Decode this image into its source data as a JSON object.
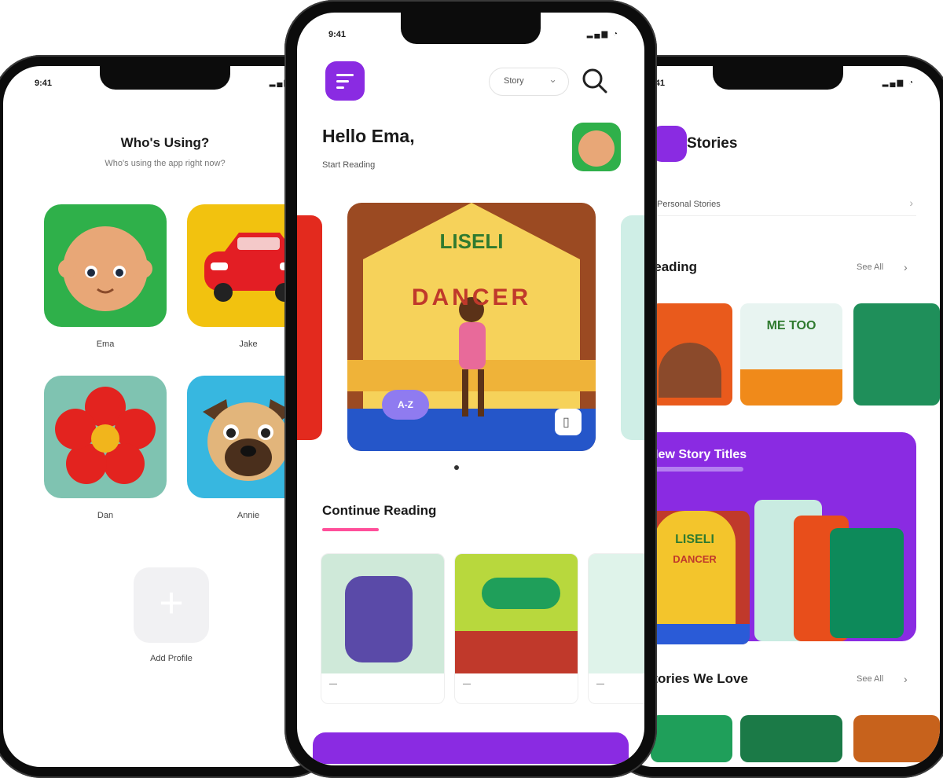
{
  "left_phone": {
    "status_time": "9:41",
    "title": "Who's Using?",
    "subtitle": "Who's using the app right now?",
    "profiles": [
      {
        "name": "Ema"
      },
      {
        "name": "Jake"
      },
      {
        "name": "Dan"
      },
      {
        "name": "Annie"
      }
    ],
    "add_label": "Add Profile"
  },
  "center_phone": {
    "status_time": "9:41",
    "language": "Story",
    "greeting": "Hello Ema,",
    "subgreeting": "Start Reading",
    "featured": {
      "cover_title_1": "LISELI",
      "cover_title_2": "DANCER",
      "level_badge": "A-Z"
    },
    "continue_title": "Continue Reading",
    "continue_books": [
      {
        "caption": "—"
      },
      {
        "caption": "—"
      },
      {
        "caption": "—"
      }
    ]
  },
  "right_phone": {
    "status_time": "9:41",
    "title": "Stories",
    "filter_label": "Personal Stories",
    "reading_title": "Reading",
    "see_all_1": "See All",
    "small_cover_text": "ME TOO",
    "banner_title": "New Story Titles",
    "banner_cover_1": "LISELI",
    "banner_cover_2": "DANCER",
    "love_title": "Stories We Love",
    "see_all_2": "See All"
  },
  "colors": {
    "accent_purple": "#8a2be2",
    "pink_underline": "#ff4f9a"
  }
}
